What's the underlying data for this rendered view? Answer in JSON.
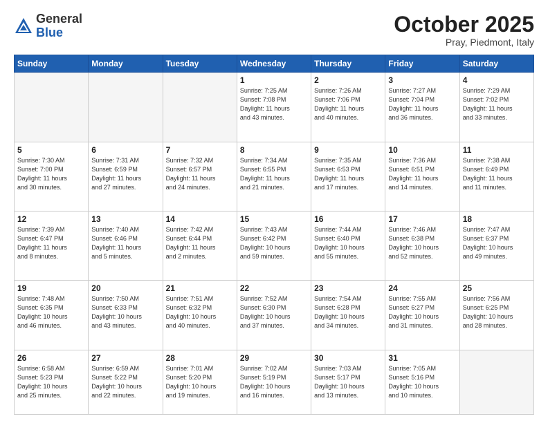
{
  "header": {
    "logo_general": "General",
    "logo_blue": "Blue",
    "month_title": "October 2025",
    "location": "Pray, Piedmont, Italy"
  },
  "weekdays": [
    "Sunday",
    "Monday",
    "Tuesday",
    "Wednesday",
    "Thursday",
    "Friday",
    "Saturday"
  ],
  "weeks": [
    [
      {
        "day": "",
        "info": ""
      },
      {
        "day": "",
        "info": ""
      },
      {
        "day": "",
        "info": ""
      },
      {
        "day": "1",
        "info": "Sunrise: 7:25 AM\nSunset: 7:08 PM\nDaylight: 11 hours\nand 43 minutes."
      },
      {
        "day": "2",
        "info": "Sunrise: 7:26 AM\nSunset: 7:06 PM\nDaylight: 11 hours\nand 40 minutes."
      },
      {
        "day": "3",
        "info": "Sunrise: 7:27 AM\nSunset: 7:04 PM\nDaylight: 11 hours\nand 36 minutes."
      },
      {
        "day": "4",
        "info": "Sunrise: 7:29 AM\nSunset: 7:02 PM\nDaylight: 11 hours\nand 33 minutes."
      }
    ],
    [
      {
        "day": "5",
        "info": "Sunrise: 7:30 AM\nSunset: 7:00 PM\nDaylight: 11 hours\nand 30 minutes."
      },
      {
        "day": "6",
        "info": "Sunrise: 7:31 AM\nSunset: 6:59 PM\nDaylight: 11 hours\nand 27 minutes."
      },
      {
        "day": "7",
        "info": "Sunrise: 7:32 AM\nSunset: 6:57 PM\nDaylight: 11 hours\nand 24 minutes."
      },
      {
        "day": "8",
        "info": "Sunrise: 7:34 AM\nSunset: 6:55 PM\nDaylight: 11 hours\nand 21 minutes."
      },
      {
        "day": "9",
        "info": "Sunrise: 7:35 AM\nSunset: 6:53 PM\nDaylight: 11 hours\nand 17 minutes."
      },
      {
        "day": "10",
        "info": "Sunrise: 7:36 AM\nSunset: 6:51 PM\nDaylight: 11 hours\nand 14 minutes."
      },
      {
        "day": "11",
        "info": "Sunrise: 7:38 AM\nSunset: 6:49 PM\nDaylight: 11 hours\nand 11 minutes."
      }
    ],
    [
      {
        "day": "12",
        "info": "Sunrise: 7:39 AM\nSunset: 6:47 PM\nDaylight: 11 hours\nand 8 minutes."
      },
      {
        "day": "13",
        "info": "Sunrise: 7:40 AM\nSunset: 6:46 PM\nDaylight: 11 hours\nand 5 minutes."
      },
      {
        "day": "14",
        "info": "Sunrise: 7:42 AM\nSunset: 6:44 PM\nDaylight: 11 hours\nand 2 minutes."
      },
      {
        "day": "15",
        "info": "Sunrise: 7:43 AM\nSunset: 6:42 PM\nDaylight: 10 hours\nand 59 minutes."
      },
      {
        "day": "16",
        "info": "Sunrise: 7:44 AM\nSunset: 6:40 PM\nDaylight: 10 hours\nand 55 minutes."
      },
      {
        "day": "17",
        "info": "Sunrise: 7:46 AM\nSunset: 6:38 PM\nDaylight: 10 hours\nand 52 minutes."
      },
      {
        "day": "18",
        "info": "Sunrise: 7:47 AM\nSunset: 6:37 PM\nDaylight: 10 hours\nand 49 minutes."
      }
    ],
    [
      {
        "day": "19",
        "info": "Sunrise: 7:48 AM\nSunset: 6:35 PM\nDaylight: 10 hours\nand 46 minutes."
      },
      {
        "day": "20",
        "info": "Sunrise: 7:50 AM\nSunset: 6:33 PM\nDaylight: 10 hours\nand 43 minutes."
      },
      {
        "day": "21",
        "info": "Sunrise: 7:51 AM\nSunset: 6:32 PM\nDaylight: 10 hours\nand 40 minutes."
      },
      {
        "day": "22",
        "info": "Sunrise: 7:52 AM\nSunset: 6:30 PM\nDaylight: 10 hours\nand 37 minutes."
      },
      {
        "day": "23",
        "info": "Sunrise: 7:54 AM\nSunset: 6:28 PM\nDaylight: 10 hours\nand 34 minutes."
      },
      {
        "day": "24",
        "info": "Sunrise: 7:55 AM\nSunset: 6:27 PM\nDaylight: 10 hours\nand 31 minutes."
      },
      {
        "day": "25",
        "info": "Sunrise: 7:56 AM\nSunset: 6:25 PM\nDaylight: 10 hours\nand 28 minutes."
      }
    ],
    [
      {
        "day": "26",
        "info": "Sunrise: 6:58 AM\nSunset: 5:23 PM\nDaylight: 10 hours\nand 25 minutes."
      },
      {
        "day": "27",
        "info": "Sunrise: 6:59 AM\nSunset: 5:22 PM\nDaylight: 10 hours\nand 22 minutes."
      },
      {
        "day": "28",
        "info": "Sunrise: 7:01 AM\nSunset: 5:20 PM\nDaylight: 10 hours\nand 19 minutes."
      },
      {
        "day": "29",
        "info": "Sunrise: 7:02 AM\nSunset: 5:19 PM\nDaylight: 10 hours\nand 16 minutes."
      },
      {
        "day": "30",
        "info": "Sunrise: 7:03 AM\nSunset: 5:17 PM\nDaylight: 10 hours\nand 13 minutes."
      },
      {
        "day": "31",
        "info": "Sunrise: 7:05 AM\nSunset: 5:16 PM\nDaylight: 10 hours\nand 10 minutes."
      },
      {
        "day": "",
        "info": ""
      }
    ]
  ]
}
